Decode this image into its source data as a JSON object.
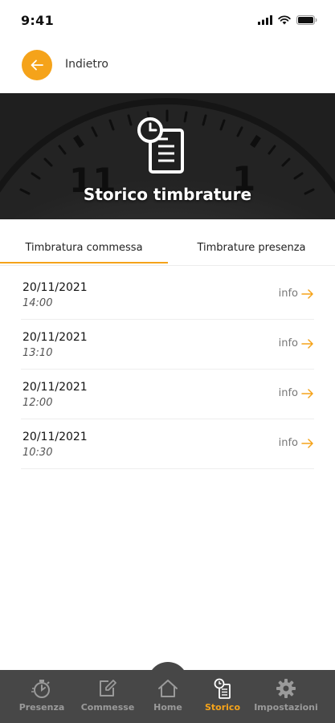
{
  "status_bar": {
    "time": "9:41"
  },
  "header": {
    "back_label": "Indietro"
  },
  "hero": {
    "title": "Storico timbrature",
    "clock_numbers": [
      "11",
      "1"
    ]
  },
  "tabs": [
    {
      "label": "Timbratura commessa",
      "active": true
    },
    {
      "label": "Timbrature presenza",
      "active": false
    }
  ],
  "records": [
    {
      "date": "20/11/2021",
      "time": "14:00",
      "info_label": "info"
    },
    {
      "date": "20/11/2021",
      "time": "13:10",
      "info_label": "info"
    },
    {
      "date": "20/11/2021",
      "time": "12:00",
      "info_label": "info"
    },
    {
      "date": "20/11/2021",
      "time": "10:30",
      "info_label": "info"
    }
  ],
  "bottom_nav": [
    {
      "label": "Presenza",
      "icon": "stopwatch-icon",
      "active": false
    },
    {
      "label": "Commesse",
      "icon": "edit-icon",
      "active": false
    },
    {
      "label": "Home",
      "icon": "home-icon",
      "active": false
    },
    {
      "label": "Storico",
      "icon": "history-icon",
      "active": true
    },
    {
      "label": "Impostazioni",
      "icon": "gear-icon",
      "active": false
    }
  ],
  "colors": {
    "accent": "#f5a31a",
    "nav_bg": "#474747",
    "nav_inactive": "#9a9a9a"
  }
}
